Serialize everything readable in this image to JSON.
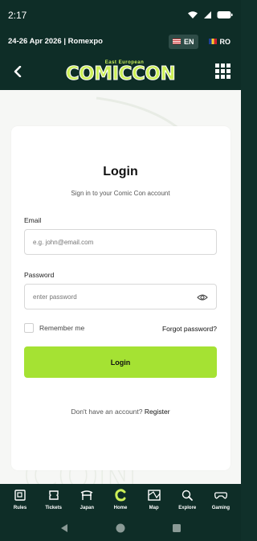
{
  "status_bar": {
    "time": "2:17"
  },
  "info_bar": {
    "dates_venue": "24-26 Apr 2026 | Romexpo",
    "languages": [
      {
        "code": "EN",
        "active": true
      },
      {
        "code": "RO",
        "active": false
      }
    ]
  },
  "header": {
    "logo_top": "East European",
    "logo_main": "COMICCON"
  },
  "login": {
    "title": "Login",
    "subtitle": "Sign in to your Comic Con account",
    "email_label": "Email",
    "email_placeholder": "e.g. john@email.com",
    "password_label": "Password",
    "password_placeholder": "enter password",
    "remember_label": "Remember me",
    "forgot_label": "Forgot password?",
    "button_label": "Login",
    "register_prompt": "Don't have an account?",
    "register_link": "Register"
  },
  "bottom_nav": {
    "items": [
      {
        "label": "Rules",
        "icon": "rules-icon"
      },
      {
        "label": "Tickets",
        "icon": "tickets-icon"
      },
      {
        "label": "Japan",
        "icon": "japan-icon"
      },
      {
        "label": "Home",
        "icon": "home-logo-icon"
      },
      {
        "label": "Map",
        "icon": "map-icon"
      },
      {
        "label": "Explore",
        "icon": "explore-icon"
      },
      {
        "label": "Gaming",
        "icon": "gaming-icon"
      }
    ]
  },
  "colors": {
    "brand_dark": "#0e2d27",
    "accent": "#a5e233",
    "logo": "#ccef57"
  }
}
